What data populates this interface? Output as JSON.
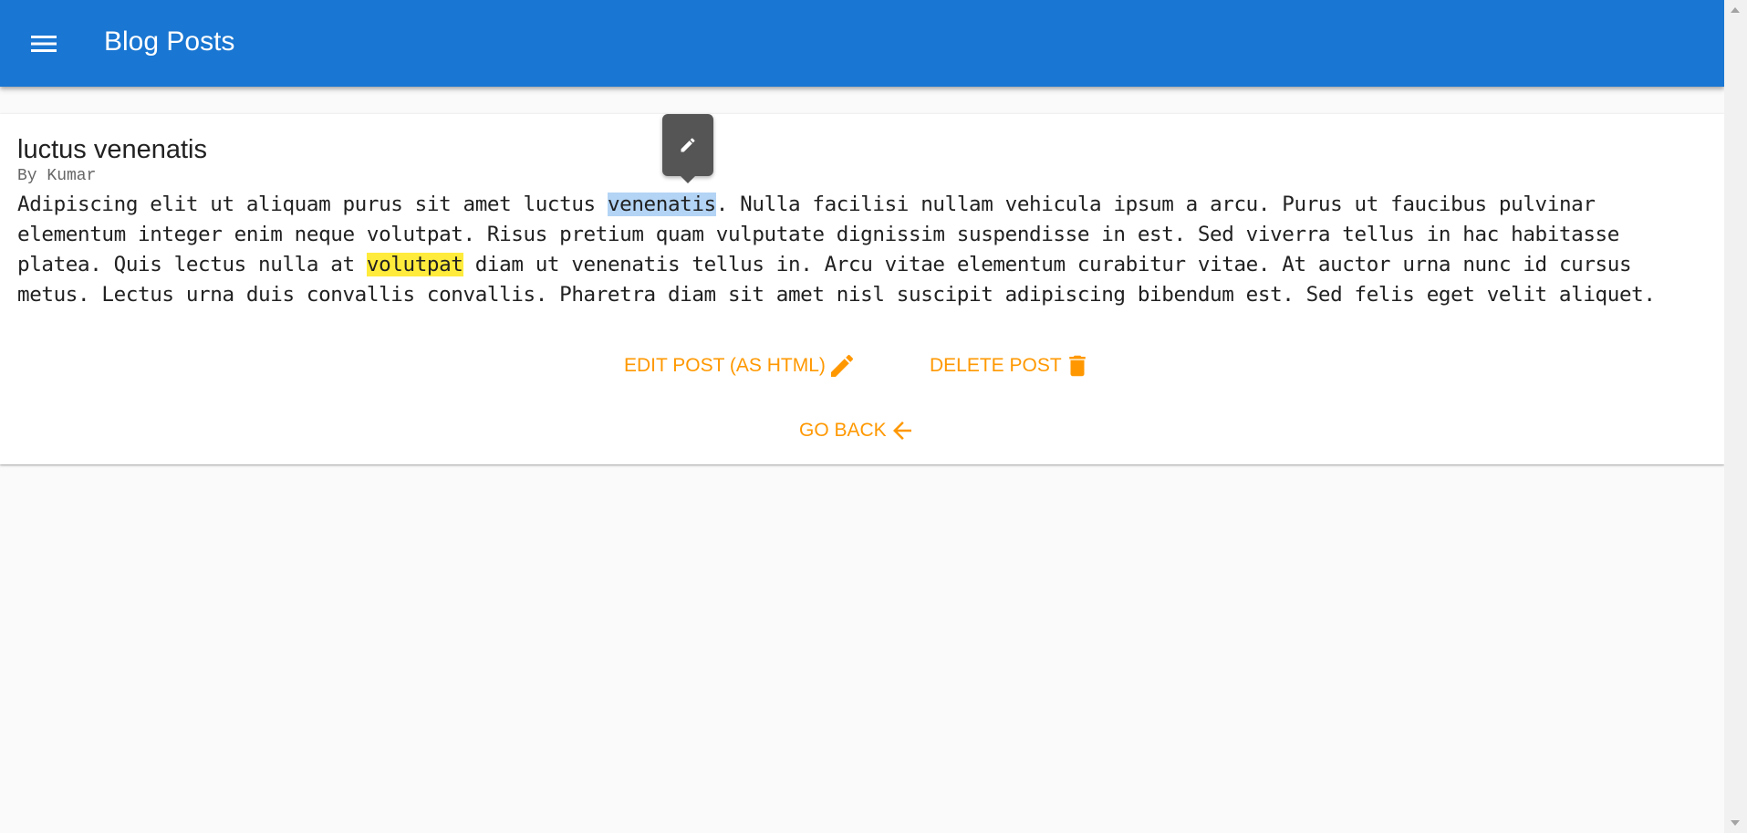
{
  "appbar": {
    "title": "Blog Posts",
    "menu_icon": "menu-icon",
    "color": "#1976d2"
  },
  "post": {
    "title": "luctus venenatis",
    "author": "By Kumar",
    "body": {
      "seg1": "Adipiscing elit ut aliquam purus sit amet luctus ",
      "selected": "venenatis",
      "seg2": ". Nulla facilisi nullam vehicula ipsum a arcu. Purus ut faucibus pulvinar elementum integer enim neque volutpat. Risus pretium quam vulputate dignissim suspendisse in est. Sed viverra tellus in hac habitasse platea. Quis lectus nulla at ",
      "highlighted": "volutpat",
      "seg3": " diam ut venenatis tellus in. Arcu vitae elementum curabitur vitae. At auctor urna nunc id cursus metus. Lectus urna duis convallis convallis. Pharetra diam sit amet nisl suscipit adipiscing bibendum est. Sed felis eget velit aliquet."
    }
  },
  "actions": {
    "edit_label": "EDIT POST (AS HTML)",
    "edit_icon": "pencil-icon",
    "delete_label": "DELETE POST",
    "delete_icon": "trash-icon",
    "back_label": "GO BACK",
    "back_icon": "arrow-left-icon",
    "accent": "#ff9800"
  },
  "tooltip": {
    "icon": "pencil-icon"
  }
}
